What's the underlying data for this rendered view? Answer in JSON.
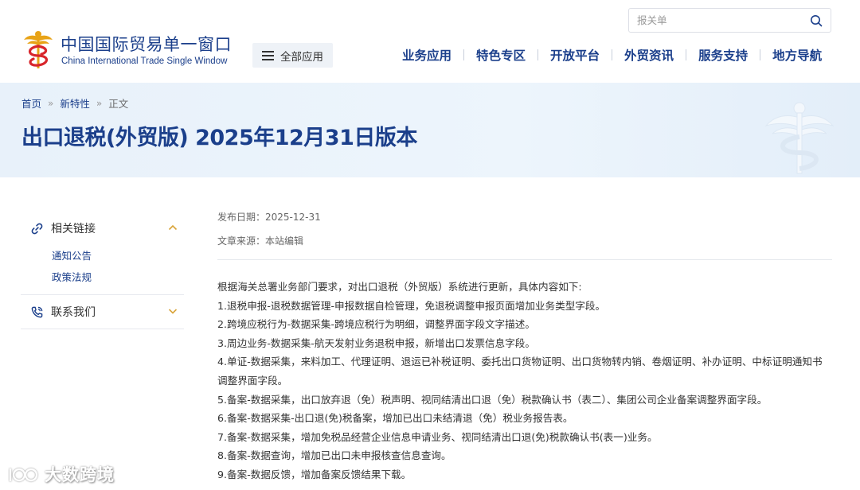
{
  "header": {
    "logo_cn": "中国国际贸易单一窗口",
    "logo_en": "China International Trade Single Window",
    "all_apps_label": "全部应用",
    "search": {
      "placeholder": "报关单",
      "value": ""
    },
    "nav": [
      "业务应用",
      "特色专区",
      "开放平台",
      "外贸资讯",
      "服务支持",
      "地方导航"
    ]
  },
  "breadcrumb": [
    "首页",
    "新特性",
    "正文"
  ],
  "page_title": "出口退税(外贸版) 2025年12月31日版本",
  "sidebar": [
    {
      "title": "相关链接",
      "icon": "link-icon",
      "expanded": true,
      "items": [
        "通知公告",
        "政策法规"
      ]
    },
    {
      "title": "联系我们",
      "icon": "phone-icon",
      "expanded": false,
      "items": []
    }
  ],
  "article": {
    "publish_date_label": "发布日期：",
    "publish_date": "2025-12-31",
    "source_label": "文章来源：",
    "source": "本站编辑",
    "paragraphs": [
      "根据海关总署业务部门要求，对出口退税（外贸版）系统进行更新，具体内容如下:",
      "1.退税申报-退税数据管理-申报数据自检管理，免退税调整申报页面增加业务类型字段。",
      "2.跨境应税行为-数据采集-跨境应税行为明细，调整界面字段文字描述。",
      "3.周边业务-数据采集-航天发射业务退税申报，新增出口发票信息字段。",
      "4.单证-数据采集，来料加工、代理证明、退运已补税证明、委托出口货物证明、出口货物转内销、卷烟证明、补办证明、中标证明通知书调整界面字段。",
      "5.备案-数据采集，出口放弃退（免）税声明、视同结清出口退（免）税款确认书（表二）、集团公司企业备案调整界面字段。",
      "6.备案-数据采集-出口退(免)税备案，增加已出口未结清退（免）税业务报告表。",
      "7.备案-数据采集，增加免税品经营企业信息申请业务、视同结清出口退(免)税款确认书(表一)业务。",
      "8.备案-数据查询，增加已出口未申报核查信息查询。",
      "9.备案-数据反馈，增加备案反馈结果下载。"
    ]
  },
  "watermark": "大数跨境",
  "colors": {
    "brand_blue": "#1b3f8b",
    "banner_bg": "#e8f1fa",
    "logo_gold": "#e8a317",
    "logo_red": "#d8262c",
    "chevron": "#d9a43a"
  }
}
